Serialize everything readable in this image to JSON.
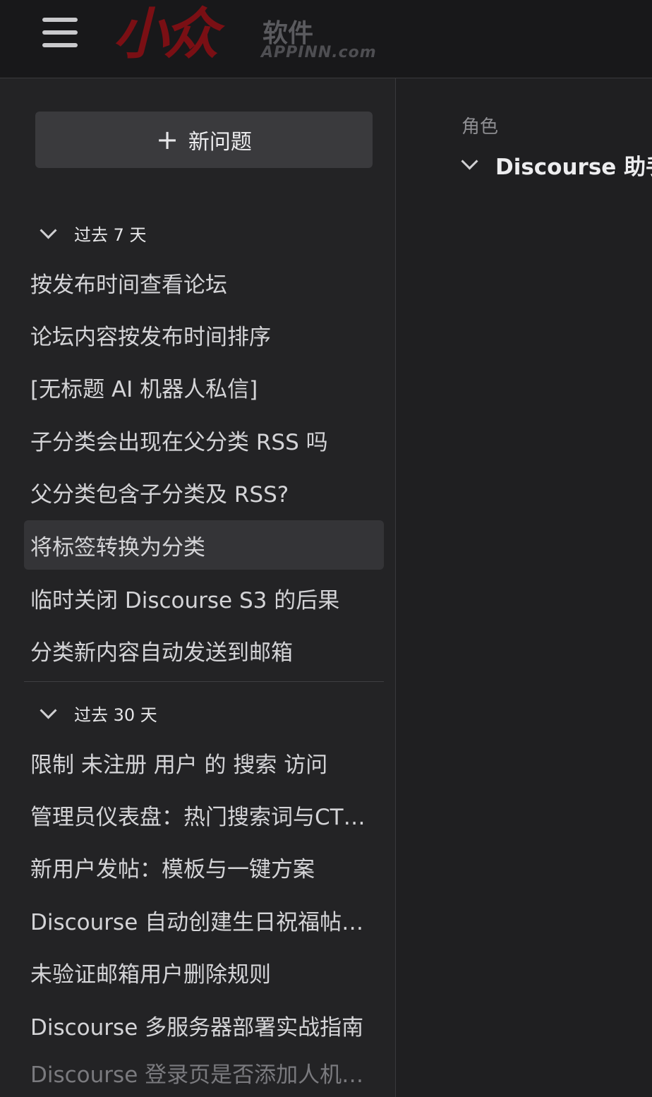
{
  "header": {
    "logo_mark": "小众",
    "logo_cn": "软件",
    "logo_en": "APPINN.com"
  },
  "sidebar": {
    "new_question_label": "新问题",
    "section_7": {
      "title": "过去 7 天",
      "items": [
        "按发布时间查看论坛",
        "论坛内容按发布时间排序",
        "[无标题 AI 机器人私信]",
        "子分类会出现在父分类 RSS 吗",
        "父分类包含子分类及 RSS?",
        "将标签转换为分类",
        "临时关闭 Discourse S3 的后果",
        "分类新内容自动发送到邮箱"
      ]
    },
    "section_30": {
      "title": "过去 30 天",
      "items": [
        "限制 未注册 用户 的 搜索 访问",
        "管理员仪表盘：热门搜索词与CT…",
        "新用户发帖：模板与一键方案",
        "Discourse 自动创建生日祝福帖…",
        "未验证邮箱用户删除规则",
        "Discourse 多服务器部署实战指南",
        "Discourse 登录页是否添加人机…"
      ]
    }
  },
  "main": {
    "role_label": "角色",
    "role_value": "Discourse 助手"
  }
}
